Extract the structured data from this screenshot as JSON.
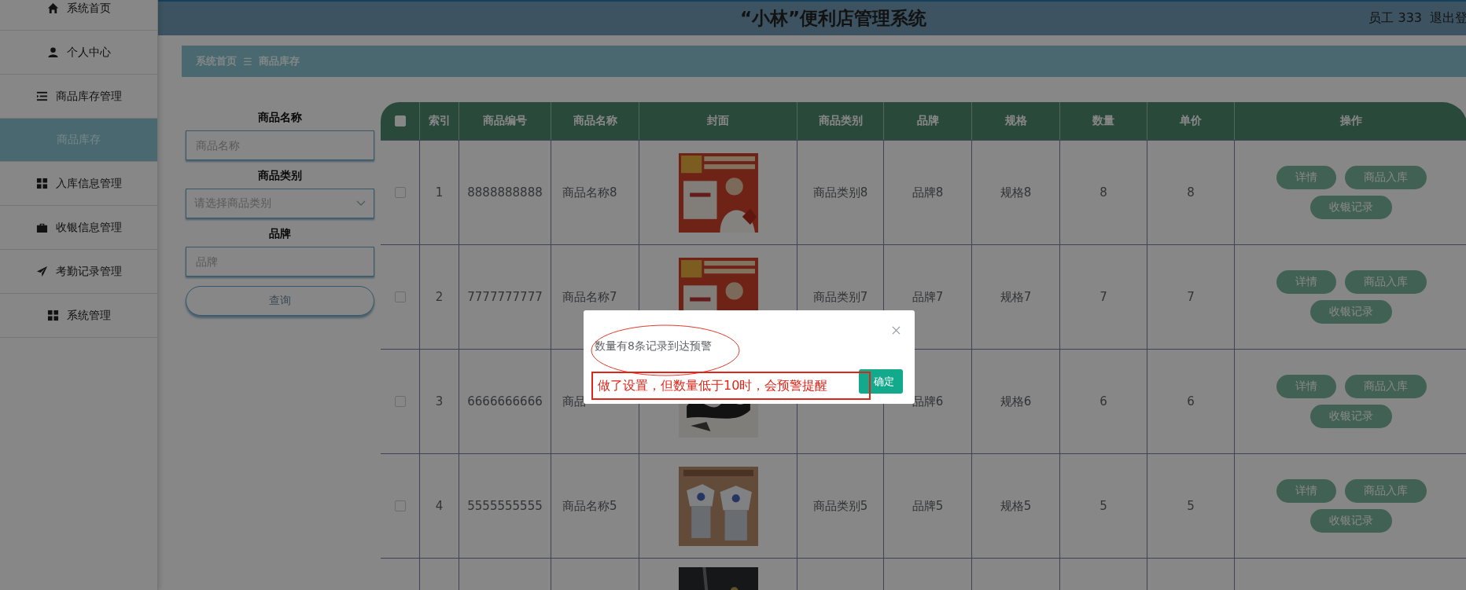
{
  "sidebar": {
    "items": [
      {
        "label": "系统首页",
        "selected": false
      },
      {
        "label": "个人中心",
        "selected": false
      },
      {
        "label": "商品库存管理",
        "selected": false,
        "expanded": true,
        "children": [
          {
            "label": "商品库存",
            "selected": true
          }
        ]
      },
      {
        "label": "入库信息管理",
        "selected": false
      },
      {
        "label": "收银信息管理",
        "selected": false
      },
      {
        "label": "考勤记录管理",
        "selected": false
      },
      {
        "label": "系统管理",
        "selected": false
      }
    ]
  },
  "header": {
    "title": "“小林”便利店管理系统",
    "user": "员工 333",
    "logout": "退出登"
  },
  "breadcrumb": {
    "items": [
      "系统首页",
      "商品库存"
    ],
    "separator": "☰"
  },
  "search": {
    "fields": [
      {
        "label": "商品名称",
        "kind": "input",
        "placeholder": "商品名称"
      },
      {
        "label": "商品类别",
        "kind": "select",
        "placeholder": "请选择商品类别"
      },
      {
        "label": "品牌",
        "kind": "input",
        "placeholder": "品牌"
      }
    ],
    "button": "查询"
  },
  "table": {
    "header_checked": false,
    "columns": [
      "索引",
      "商品编号",
      "商品名称",
      "封面",
      "商品类别",
      "品牌",
      "规格",
      "数量",
      "单价",
      "操作"
    ],
    "rows": [
      {
        "checked": false,
        "index": "1",
        "code": "8888888888",
        "name": "商品名称8",
        "cover": {
          "kind": "picture"
        },
        "category": "商品类别8",
        "brand": "品牌8",
        "spec": "规格8",
        "quantity": "8",
        "price": "8",
        "actions": [
          "详情",
          "商品入库",
          "收银记录"
        ]
      },
      {
        "checked": false,
        "index": "2",
        "code": "7777777777",
        "name": "商品名称7",
        "cover": {
          "kind": "picture"
        },
        "category": "商品类别7",
        "brand": "品牌7",
        "spec": "规格7",
        "quantity": "7",
        "price": "7",
        "actions": [
          "详情",
          "商品入库",
          "收银记录"
        ]
      },
      {
        "checked": false,
        "index": "3",
        "code": "6666666666",
        "name": "商品",
        "cover": {
          "kind": "picture"
        },
        "brand": "品牌6",
        "spec": "规格6",
        "quantity": "6",
        "price": "6",
        "actions": [
          "详情",
          "商品入库",
          "收银记录"
        ]
      },
      {
        "checked": false,
        "index": "4",
        "code": "5555555555",
        "name": "商品名称5",
        "cover": {
          "kind": "picture"
        },
        "category": "商品类别5",
        "brand": "品牌5",
        "spec": "规格5",
        "quantity": "5",
        "price": "5",
        "actions": [
          "详情",
          "商品入库",
          "收银记录"
        ]
      },
      {
        "cover": {
          "kind": "picture"
        }
      }
    ]
  },
  "dialog": {
    "message": "数量有8条记录到达预警",
    "button": "确定",
    "annotation": "做了设置，但数量低于10时，会预警提醒"
  }
}
